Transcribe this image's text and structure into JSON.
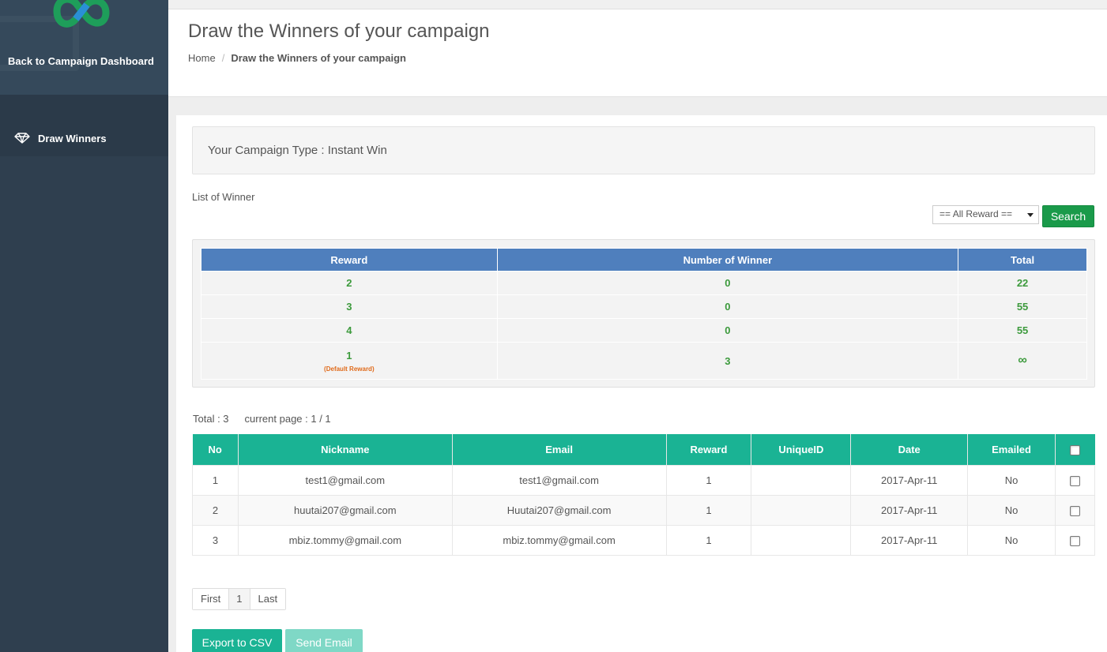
{
  "sidebar": {
    "back_link": "Back to Campaign Dashboard",
    "nav_items": [
      {
        "label": "Draw Winners",
        "icon": "diamond-icon"
      }
    ]
  },
  "header": {
    "title": "Draw the Winners of your campaign",
    "breadcrumb": [
      "Home",
      "Draw the Winners of your campaign"
    ]
  },
  "campaign": {
    "type_label": "Your Campaign Type : Instant Win"
  },
  "winner_list": {
    "title": "List of Winner",
    "filter_selected": "== All Reward ==",
    "search_label": "Search"
  },
  "reward_table": {
    "headers": [
      "Reward",
      "Number of Winner",
      "Total"
    ],
    "rows": [
      {
        "reward": "2",
        "note": "",
        "winners": "0",
        "total": "22"
      },
      {
        "reward": "3",
        "note": "",
        "winners": "0",
        "total": "55"
      },
      {
        "reward": "4",
        "note": "",
        "winners": "0",
        "total": "55"
      },
      {
        "reward": "1",
        "note": "(Default Reward)",
        "winners": "3",
        "total": "∞"
      }
    ]
  },
  "summary": {
    "total": "Total : 3",
    "page": "current page : 1 / 1"
  },
  "winners_table": {
    "headers": [
      "No",
      "Nickname",
      "Email",
      "Reward",
      "UniqueID",
      "Date",
      "Emailed"
    ],
    "rows": [
      {
        "no": "1",
        "nickname": "test1@gmail.com",
        "email": "test1@gmail.com",
        "reward": "1",
        "unique_id": "",
        "date": "2017-Apr-11",
        "emailed": "No"
      },
      {
        "no": "2",
        "nickname": "huutai207@gmail.com",
        "email": "Huutai207@gmail.com",
        "reward": "1",
        "unique_id": "",
        "date": "2017-Apr-11",
        "emailed": "No"
      },
      {
        "no": "3",
        "nickname": "mbiz.tommy@gmail.com",
        "email": "mbiz.tommy@gmail.com",
        "reward": "1",
        "unique_id": "",
        "date": "2017-Apr-11",
        "emailed": "No"
      }
    ]
  },
  "pagination": {
    "first": "First",
    "current": "1",
    "last": "Last"
  },
  "actions": {
    "export": "Export to CSV",
    "send_email": "Send Email"
  },
  "colors": {
    "sidebar": "#2f3f4f",
    "reward_header": "#4f7fbd",
    "table_header": "#1ab394",
    "search_button": "#1a9a4a",
    "reward_values": "#3c9a3c",
    "default_note": "#e06a1a"
  }
}
